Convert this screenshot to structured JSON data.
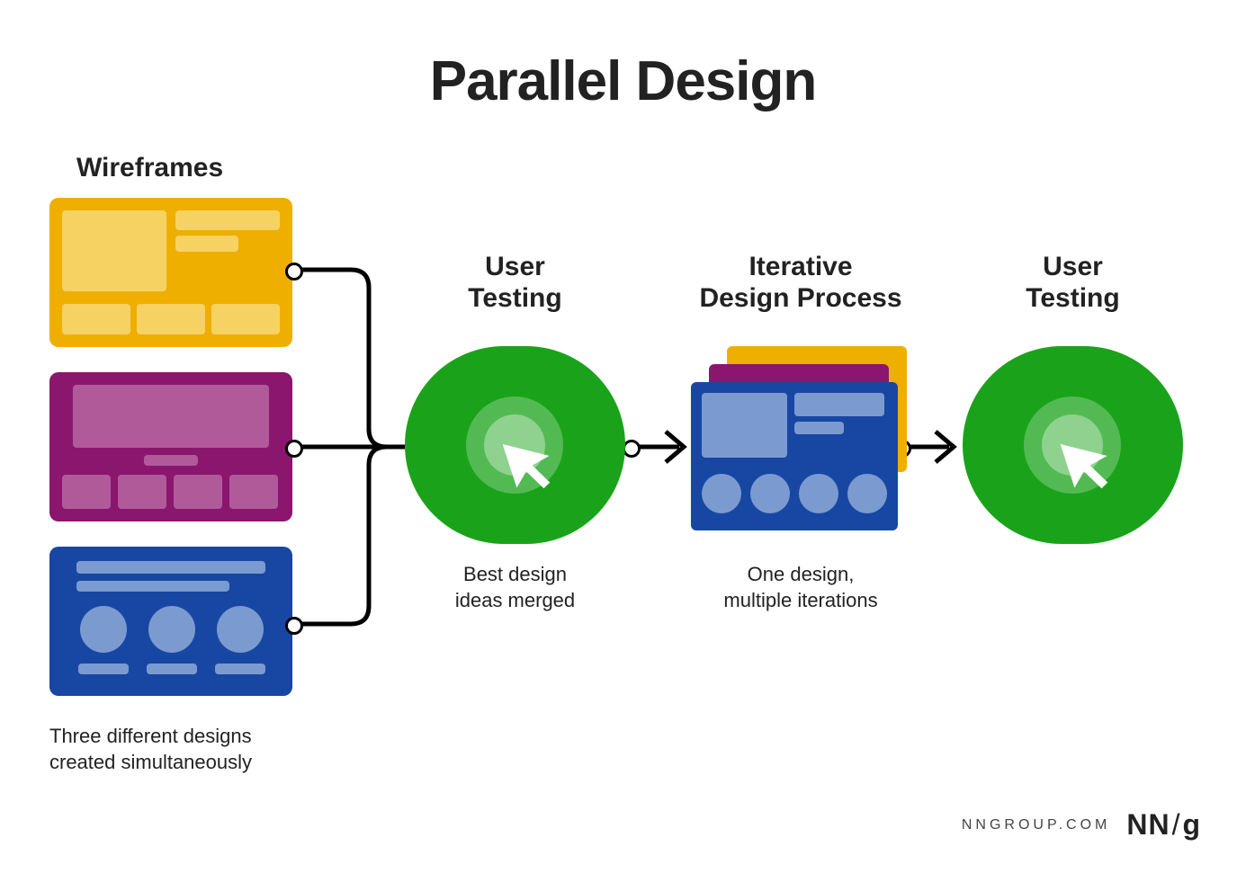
{
  "title": "Parallel Design",
  "sections": {
    "wireframes": {
      "label": "Wireframes",
      "caption": "Three different designs\ncreated simultaneously"
    },
    "user_testing_1": {
      "label": "User\nTesting",
      "caption": "Best design\nideas merged"
    },
    "iterative": {
      "label": "Iterative\nDesign Process",
      "caption": "One design,\nmultiple iterations"
    },
    "user_testing_2": {
      "label": "User\nTesting"
    }
  },
  "attribution": {
    "url": "NNGROUP.COM",
    "logo_a": "NN",
    "logo_b": "g"
  },
  "colors": {
    "yellow": "#eeaf00",
    "purple": "#8b166e",
    "blue": "#1847a3",
    "green": "#1aa31a"
  }
}
